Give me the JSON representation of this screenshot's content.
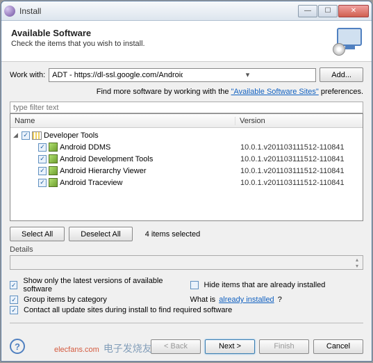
{
  "window": {
    "title": "Install"
  },
  "header": {
    "title": "Available Software",
    "subtitle": "Check the items that you wish to install."
  },
  "work_with": {
    "label": "Work with:",
    "value": "ADT - https://dl-ssl.google.com/Android/eclipse/",
    "add_button": "Add..."
  },
  "hint": {
    "prefix": "Find more software by working with the ",
    "link": "\"Available Software Sites\"",
    "suffix": " preferences."
  },
  "filter_placeholder": "type filter text",
  "columns": {
    "name": "Name",
    "version": "Version"
  },
  "tree": {
    "root": {
      "label": "Developer Tools",
      "checked": true
    },
    "items": [
      {
        "label": "Android DDMS",
        "version": "10.0.1.v201103111512-110841",
        "checked": true
      },
      {
        "label": "Android Development Tools",
        "version": "10.0.1.v201103111512-110841",
        "checked": true
      },
      {
        "label": "Android Hierarchy Viewer",
        "version": "10.0.1.v201103111512-110841",
        "checked": true
      },
      {
        "label": "Android Traceview",
        "version": "10.0.1.v201103111512-110841",
        "checked": true
      }
    ]
  },
  "selection": {
    "select_all": "Select All",
    "deselect_all": "Deselect All",
    "count_text": "4 items selected"
  },
  "details_label": "Details",
  "options": {
    "show_latest": {
      "label": "Show only the latest versions of available software",
      "checked": true
    },
    "hide_installed": {
      "label": "Hide items that are already installed",
      "checked": false
    },
    "group_category": {
      "label": "Group items by category",
      "checked": true
    },
    "what_is_prefix": "What is ",
    "what_is_link": "already installed",
    "contact_sites": {
      "label": "Contact all update sites during install to find required software",
      "checked": true
    }
  },
  "footer": {
    "back": "< Back",
    "next": "Next >",
    "finish": "Finish",
    "cancel": "Cancel"
  },
  "watermark": {
    "en": "elecfans.com",
    "cn": "电子发烧友"
  }
}
